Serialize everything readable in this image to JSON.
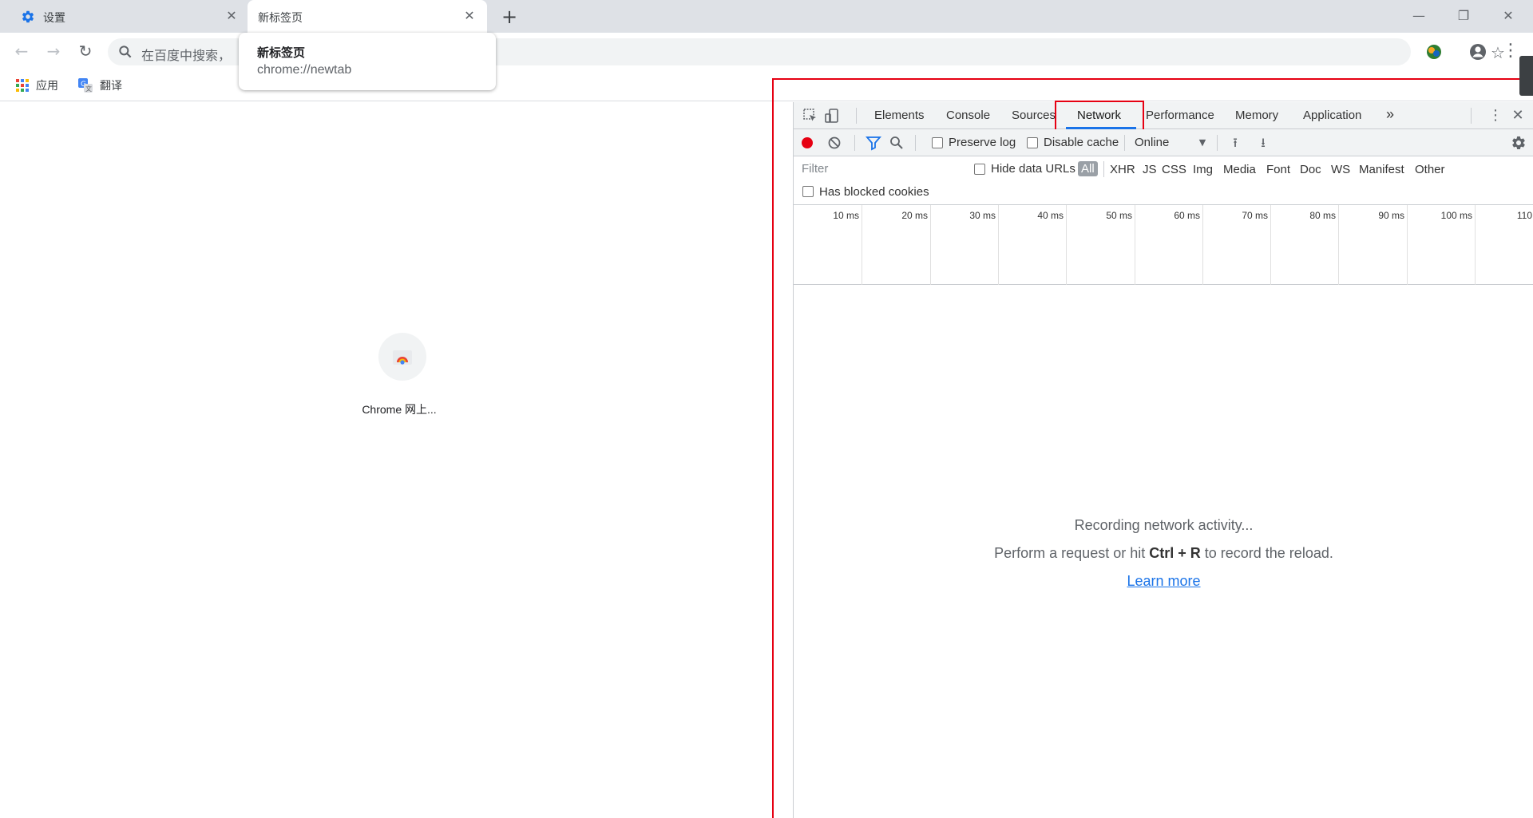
{
  "tabs": [
    {
      "label": "设置",
      "icon": "gear-icon"
    },
    {
      "label": "新标签页",
      "icon": ""
    }
  ],
  "window": {
    "minimize": "—",
    "restore": "❐",
    "close": "✕"
  },
  "omnibox": {
    "placeholder": "在百度中搜索，"
  },
  "bookmarks": [
    {
      "label": "应用",
      "icon": "apps-grid-icon"
    },
    {
      "label": "翻译",
      "icon": "translate-icon"
    }
  ],
  "hovercard": {
    "title": "新标签页",
    "url": "chrome://newtab"
  },
  "ntp": {
    "shortcut_label": "Chrome 网上..."
  },
  "devtools": {
    "tabs": [
      "Elements",
      "Console",
      "Sources",
      "Network",
      "Performance",
      "Memory",
      "Application"
    ],
    "selected_tab": "Network",
    "more_tabs": "»",
    "toolbar": {
      "preserve_log": "Preserve log",
      "disable_cache": "Disable cache",
      "throttling": "Online"
    },
    "filter": {
      "placeholder": "Filter",
      "hide_data_urls": "Hide data URLs",
      "types": [
        "All",
        "XHR",
        "JS",
        "CSS",
        "Img",
        "Media",
        "Font",
        "Doc",
        "WS",
        "Manifest",
        "Other"
      ]
    },
    "has_blocked_cookies": "Has blocked cookies",
    "timeline_ticks": [
      "10 ms",
      "20 ms",
      "30 ms",
      "40 ms",
      "50 ms",
      "60 ms",
      "70 ms",
      "80 ms",
      "90 ms",
      "100 ms",
      "110"
    ],
    "empty": {
      "line1": "Recording network activity...",
      "line2_pre": "Perform a request or hit ",
      "line2_key": "Ctrl + R",
      "line2_post": " to record the reload.",
      "learn_more": "Learn more"
    }
  },
  "colors": {
    "accent": "#1a73e8",
    "highlight": "#e60012",
    "record": "#e60012"
  }
}
